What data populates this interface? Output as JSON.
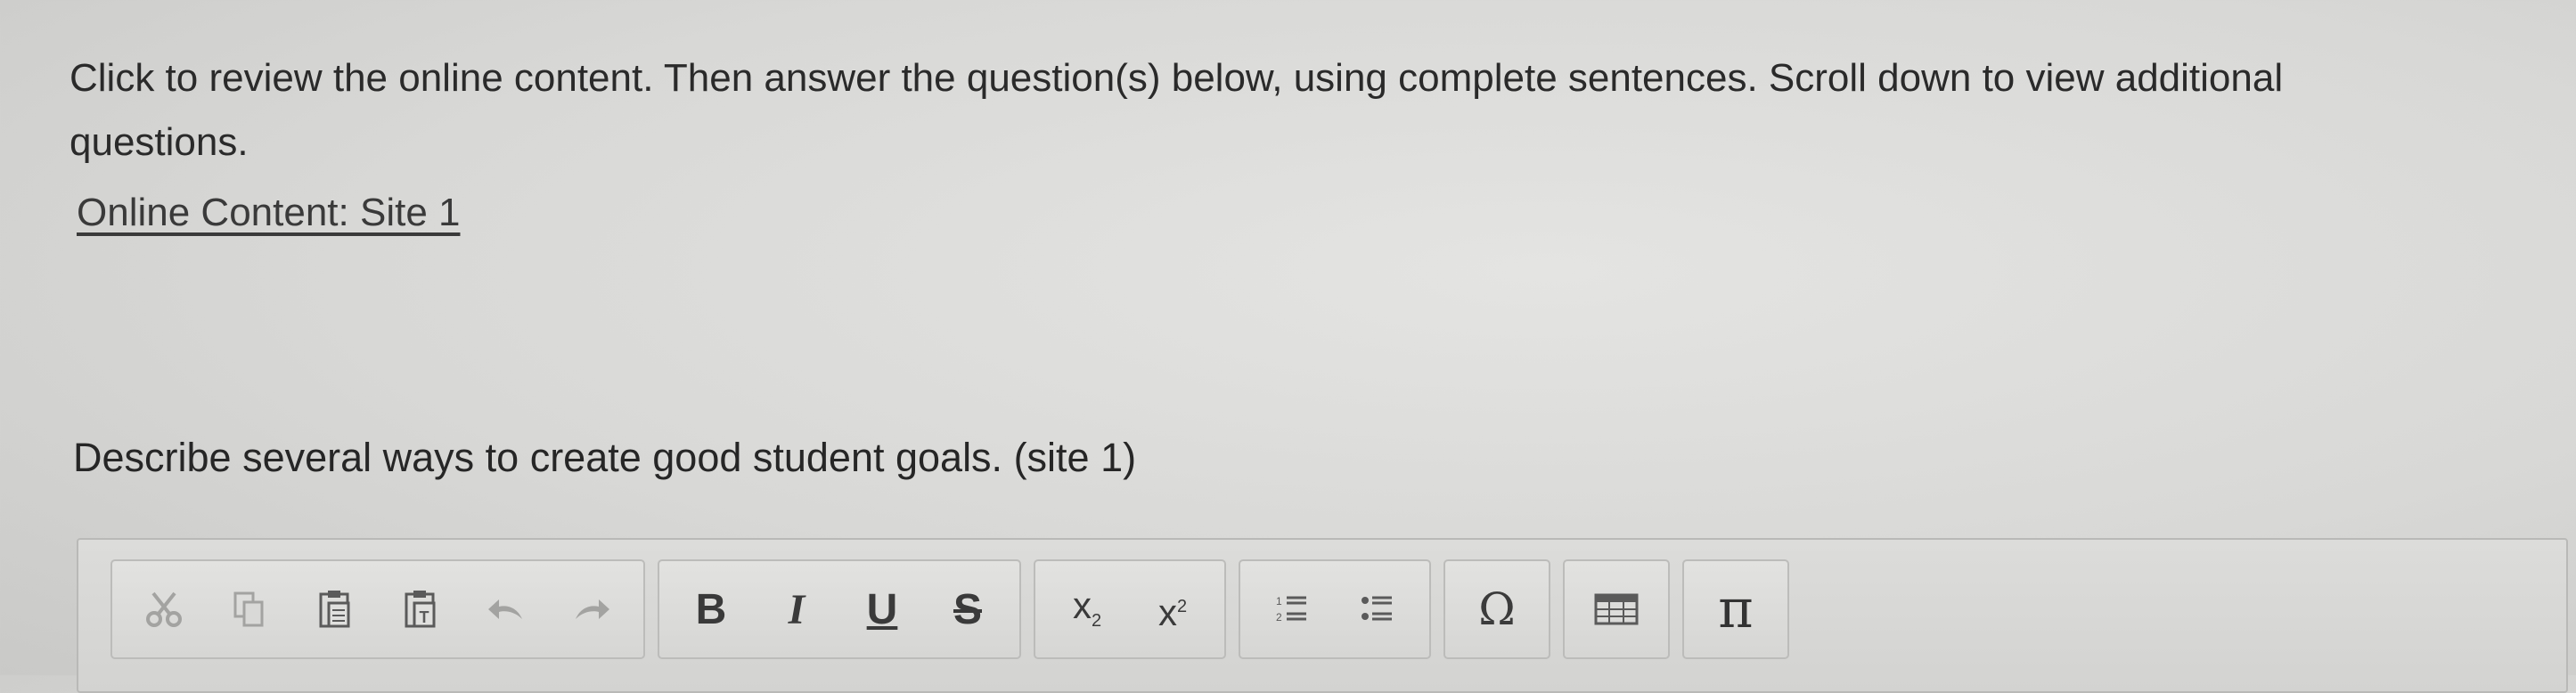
{
  "instructions": {
    "line1": "Click to review the online content. Then answer the question(s) below, using complete sentences. Scroll down to view additional",
    "line2": "questions."
  },
  "online_content_link": "Online Content: Site 1",
  "question": "Describe several ways to create good student goals. (site 1)",
  "toolbar": {
    "bold": "B",
    "italic": "I",
    "underline": "U",
    "strikethrough": "S",
    "subscript": "x",
    "subscript_mark": "2",
    "superscript": "x",
    "superscript_mark": "2",
    "special_char": "Ω",
    "math": "π",
    "icons": [
      "cut-icon",
      "copy-icon",
      "paste-icon",
      "paste-text-icon",
      "undo-icon",
      "redo-icon",
      "numbered-list-icon",
      "bulleted-list-icon",
      "table-icon"
    ]
  }
}
